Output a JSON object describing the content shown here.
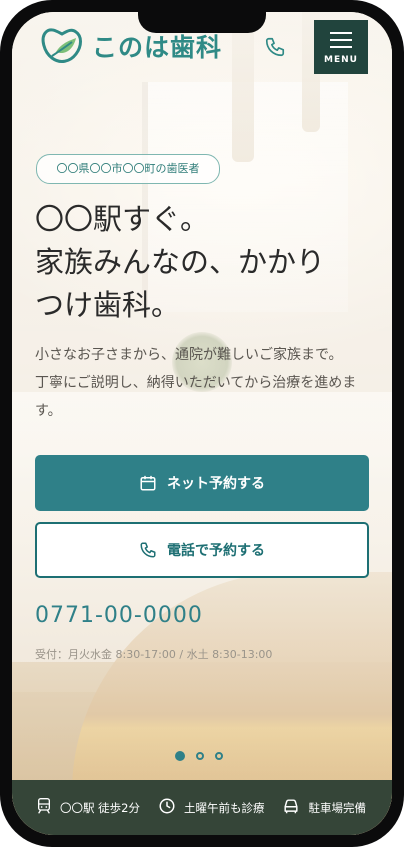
{
  "header": {
    "logo_text": "このは歯科",
    "menu_label": "MENU"
  },
  "hero": {
    "badge": "〇〇県〇〇市〇〇町の歯医者",
    "headline": "〇〇駅すぐ。\n家族みんなの、かかり\nつけ歯科。",
    "lead": "小さなお子さまから、通院が難しいご家族まで。\n丁寧にご説明し、納得いただいてから治療を進めま\nす。"
  },
  "buttons": {
    "net_reserve": "ネット予約する",
    "tel_reserve": "電話で予約する"
  },
  "contact": {
    "phone": "0771-00-0000",
    "hours": "受付：月火水金 8:30-17:00 / 水土 8:30-13:00"
  },
  "carousel": {
    "slides": 3,
    "active": 1
  },
  "info": {
    "items": [
      {
        "label": "〇〇駅 徒歩2分",
        "icon": "train-icon"
      },
      {
        "label": "土曜午前も診療",
        "icon": "clock-icon"
      },
      {
        "label": "駐車場完備",
        "icon": "car-icon"
      }
    ]
  },
  "colors": {
    "brand": "#2f8088",
    "logo": "#2f8a86",
    "menu_bg": "#21443d",
    "infobar_bg": "#354538"
  }
}
